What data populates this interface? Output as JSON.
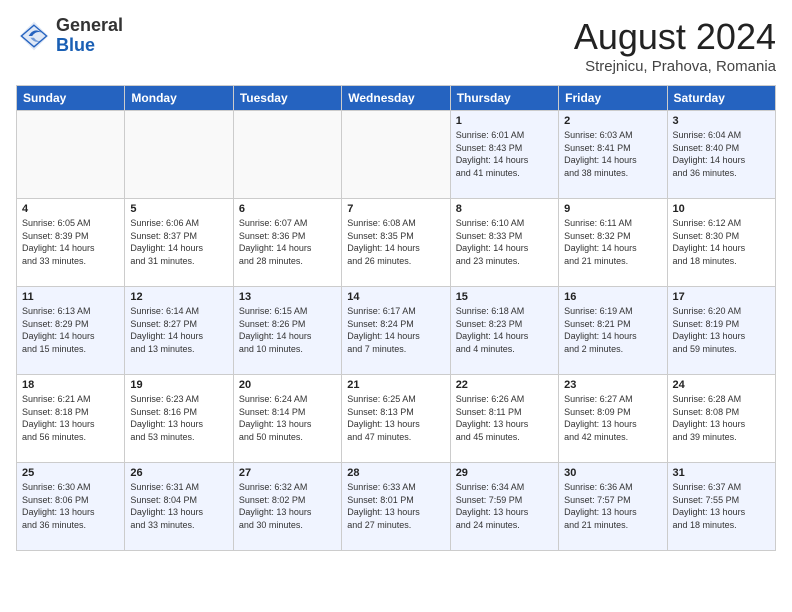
{
  "header": {
    "logo_general": "General",
    "logo_blue": "Blue",
    "month_year": "August 2024",
    "location": "Strejnicu, Prahova, Romania"
  },
  "days_of_week": [
    "Sunday",
    "Monday",
    "Tuesday",
    "Wednesday",
    "Thursday",
    "Friday",
    "Saturday"
  ],
  "weeks": [
    [
      {
        "day": "",
        "info": ""
      },
      {
        "day": "",
        "info": ""
      },
      {
        "day": "",
        "info": ""
      },
      {
        "day": "",
        "info": ""
      },
      {
        "day": "1",
        "info": "Sunrise: 6:01 AM\nSunset: 8:43 PM\nDaylight: 14 hours\nand 41 minutes."
      },
      {
        "day": "2",
        "info": "Sunrise: 6:03 AM\nSunset: 8:41 PM\nDaylight: 14 hours\nand 38 minutes."
      },
      {
        "day": "3",
        "info": "Sunrise: 6:04 AM\nSunset: 8:40 PM\nDaylight: 14 hours\nand 36 minutes."
      }
    ],
    [
      {
        "day": "4",
        "info": "Sunrise: 6:05 AM\nSunset: 8:39 PM\nDaylight: 14 hours\nand 33 minutes."
      },
      {
        "day": "5",
        "info": "Sunrise: 6:06 AM\nSunset: 8:37 PM\nDaylight: 14 hours\nand 31 minutes."
      },
      {
        "day": "6",
        "info": "Sunrise: 6:07 AM\nSunset: 8:36 PM\nDaylight: 14 hours\nand 28 minutes."
      },
      {
        "day": "7",
        "info": "Sunrise: 6:08 AM\nSunset: 8:35 PM\nDaylight: 14 hours\nand 26 minutes."
      },
      {
        "day": "8",
        "info": "Sunrise: 6:10 AM\nSunset: 8:33 PM\nDaylight: 14 hours\nand 23 minutes."
      },
      {
        "day": "9",
        "info": "Sunrise: 6:11 AM\nSunset: 8:32 PM\nDaylight: 14 hours\nand 21 minutes."
      },
      {
        "day": "10",
        "info": "Sunrise: 6:12 AM\nSunset: 8:30 PM\nDaylight: 14 hours\nand 18 minutes."
      }
    ],
    [
      {
        "day": "11",
        "info": "Sunrise: 6:13 AM\nSunset: 8:29 PM\nDaylight: 14 hours\nand 15 minutes."
      },
      {
        "day": "12",
        "info": "Sunrise: 6:14 AM\nSunset: 8:27 PM\nDaylight: 14 hours\nand 13 minutes."
      },
      {
        "day": "13",
        "info": "Sunrise: 6:15 AM\nSunset: 8:26 PM\nDaylight: 14 hours\nand 10 minutes."
      },
      {
        "day": "14",
        "info": "Sunrise: 6:17 AM\nSunset: 8:24 PM\nDaylight: 14 hours\nand 7 minutes."
      },
      {
        "day": "15",
        "info": "Sunrise: 6:18 AM\nSunset: 8:23 PM\nDaylight: 14 hours\nand 4 minutes."
      },
      {
        "day": "16",
        "info": "Sunrise: 6:19 AM\nSunset: 8:21 PM\nDaylight: 14 hours\nand 2 minutes."
      },
      {
        "day": "17",
        "info": "Sunrise: 6:20 AM\nSunset: 8:19 PM\nDaylight: 13 hours\nand 59 minutes."
      }
    ],
    [
      {
        "day": "18",
        "info": "Sunrise: 6:21 AM\nSunset: 8:18 PM\nDaylight: 13 hours\nand 56 minutes."
      },
      {
        "day": "19",
        "info": "Sunrise: 6:23 AM\nSunset: 8:16 PM\nDaylight: 13 hours\nand 53 minutes."
      },
      {
        "day": "20",
        "info": "Sunrise: 6:24 AM\nSunset: 8:14 PM\nDaylight: 13 hours\nand 50 minutes."
      },
      {
        "day": "21",
        "info": "Sunrise: 6:25 AM\nSunset: 8:13 PM\nDaylight: 13 hours\nand 47 minutes."
      },
      {
        "day": "22",
        "info": "Sunrise: 6:26 AM\nSunset: 8:11 PM\nDaylight: 13 hours\nand 45 minutes."
      },
      {
        "day": "23",
        "info": "Sunrise: 6:27 AM\nSunset: 8:09 PM\nDaylight: 13 hours\nand 42 minutes."
      },
      {
        "day": "24",
        "info": "Sunrise: 6:28 AM\nSunset: 8:08 PM\nDaylight: 13 hours\nand 39 minutes."
      }
    ],
    [
      {
        "day": "25",
        "info": "Sunrise: 6:30 AM\nSunset: 8:06 PM\nDaylight: 13 hours\nand 36 minutes."
      },
      {
        "day": "26",
        "info": "Sunrise: 6:31 AM\nSunset: 8:04 PM\nDaylight: 13 hours\nand 33 minutes."
      },
      {
        "day": "27",
        "info": "Sunrise: 6:32 AM\nSunset: 8:02 PM\nDaylight: 13 hours\nand 30 minutes."
      },
      {
        "day": "28",
        "info": "Sunrise: 6:33 AM\nSunset: 8:01 PM\nDaylight: 13 hours\nand 27 minutes."
      },
      {
        "day": "29",
        "info": "Sunrise: 6:34 AM\nSunset: 7:59 PM\nDaylight: 13 hours\nand 24 minutes."
      },
      {
        "day": "30",
        "info": "Sunrise: 6:36 AM\nSunset: 7:57 PM\nDaylight: 13 hours\nand 21 minutes."
      },
      {
        "day": "31",
        "info": "Sunrise: 6:37 AM\nSunset: 7:55 PM\nDaylight: 13 hours\nand 18 minutes."
      }
    ]
  ]
}
